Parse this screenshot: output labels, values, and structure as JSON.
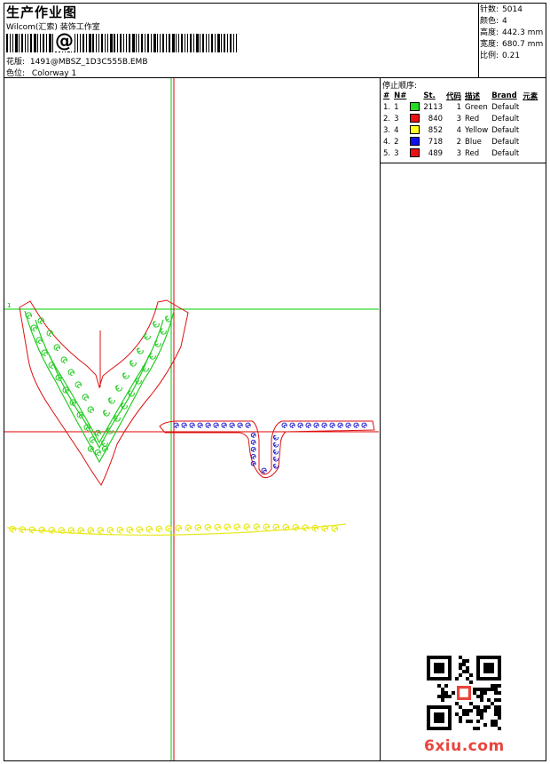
{
  "header": {
    "title": "生产作业图",
    "studio": "Wilcom(汇索) 装饰工作室",
    "barcode_symbol": "@",
    "design_label": "花版:",
    "design_value": "1491@MBSZ_1D3C555B.EMB",
    "colorway_label": "色位:",
    "colorway_value": "Colorway 1"
  },
  "stats": [
    {
      "label": "针数:",
      "value": "5014"
    },
    {
      "label": "颜色:",
      "value": "4"
    },
    {
      "label": "高度:",
      "value": "442.3 mm"
    },
    {
      "label": "宽度:",
      "value": "680.7 mm"
    },
    {
      "label": "比例:",
      "value": "0.21"
    }
  ],
  "stop_sequence": {
    "title": "停止顺序:",
    "columns": [
      "#",
      "N#",
      "St.",
      "代码",
      "描述",
      "Brand",
      "元素"
    ],
    "rows": [
      {
        "idx": "1.",
        "n": "1",
        "st": "2113",
        "code": "1",
        "desc": "Green",
        "brand": "Default",
        "color": "#22dd22"
      },
      {
        "idx": "2.",
        "n": "3",
        "st": "840",
        "code": "3",
        "desc": "Red",
        "brand": "Default",
        "color": "#ee1111"
      },
      {
        "idx": "3.",
        "n": "4",
        "st": "852",
        "code": "4",
        "desc": "Yellow",
        "brand": "Default",
        "color": "#ffff22"
      },
      {
        "idx": "4.",
        "n": "2",
        "st": "718",
        "code": "2",
        "desc": "Blue",
        "brand": "Default",
        "color": "#1111ee"
      },
      {
        "idx": "5.",
        "n": "3",
        "st": "489",
        "code": "3",
        "desc": "Red",
        "brand": "Default",
        "color": "#ee1111"
      }
    ]
  },
  "colors": {
    "green": "#22cc22",
    "red": "#dd1111",
    "yellow": "#e8e820",
    "blue": "#2222cc",
    "guide_green": "#00cc00",
    "guide_red": "#dd0000"
  },
  "watermark": "6xiu.com"
}
